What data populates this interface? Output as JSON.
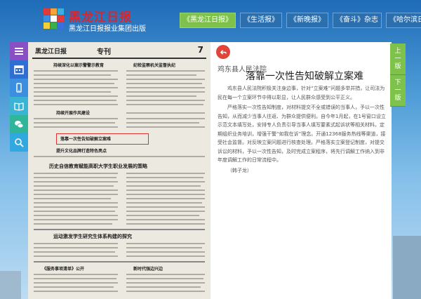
{
  "header": {
    "brand_title": "黑龙江日报",
    "brand_subtitle": "黑龙江日报报业集团出版",
    "nav": [
      {
        "label": "《黑龙江日报》",
        "active": true
      },
      {
        "label": "《生活报》",
        "active": false
      },
      {
        "label": "《新晚报》",
        "active": false
      },
      {
        "label": "《奋斗》杂志",
        "active": false
      },
      {
        "label": "《哈尔滨日报》",
        "active": false
      }
    ]
  },
  "toolbar": {
    "items": [
      "menu-icon",
      "calendar-icon",
      "mobile-icon",
      "book-icon",
      "wechat-icon",
      "search-icon"
    ]
  },
  "paper": {
    "masthead_left": "黑龙江日报",
    "masthead_center": "专刊",
    "page_number": "7",
    "headlines": [
      "持续深化以案示警警示教育",
      "纪检监察机关监督执纪",
      "持续开展作风建设",
      "落靠一次性告知破解立案难",
      "提升文化品牌打造特色亮点",
      "历史自信教育赋能高职大学生职业发展的策略",
      "运动激发学生研究生体系构建的探究",
      "《服务事项清单》公开",
      "新时代强边兴边"
    ]
  },
  "article": {
    "source": "鸡东县人民法院",
    "title": "落靠一次性告知破解立案难",
    "paragraphs": [
      "鸡东县人民法院积极关注身边事，针对“立案难”问题多举并措，让司法为民在每一个立案环节中得以彰显，让人民群众感受到公平正义。",
      "严格落实一次性告知制度，对材料提交不全或错误的当事人，予以一次性告知，从而减少当事人往返、为群众提供便利。自今年1月起，在1号窗口设立示范文本填写处，安排专人负责引导当事人填写要素式起诉状等相关材料。定期组织业务培训，增强干警“如我在诉”理念。开通12368服务热线等渠道，接受社会监督。对反映立案问题进行核查处理。严格落实立案登记制度，对提交诉讼的材料，予以一次性告知，及时完成立案程序，将先行调解工作纳入到非年度调解工作的日常流程中。",
      "（韩子龙）"
    ]
  },
  "pager": {
    "prev_label": "上一版",
    "next_label": "下一版"
  },
  "colors": {
    "nav_active": "#7fc24b",
    "nav_default": "#2c6fae",
    "toolbar": [
      "#8a4fc4",
      "#2f6fd4",
      "#3c8fe0",
      "#3ab3d4",
      "#2fb59a",
      "#32a8e0"
    ],
    "back_button": "#e0453a"
  }
}
